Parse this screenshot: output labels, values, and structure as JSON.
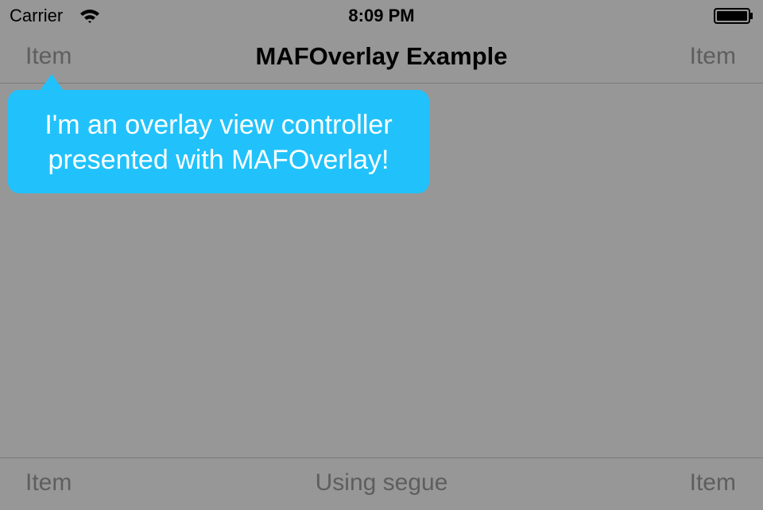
{
  "status_bar": {
    "carrier": "Carrier",
    "time": "8:09 PM",
    "wifi_icon": "wifi-icon",
    "battery_icon": "battery-icon"
  },
  "nav_bar": {
    "left_item": "Item",
    "title": "MAFOverlay Example",
    "right_item": "Item"
  },
  "overlay": {
    "text": "I'm an overlay view controller\npresented with MAFOverlay!",
    "color": "#21c2fb"
  },
  "toolbar": {
    "left_item": "Item",
    "center_item": "Using segue",
    "right_item": "Item"
  },
  "colors": {
    "background": "#979797",
    "bar_item": "#5e5e5e"
  }
}
